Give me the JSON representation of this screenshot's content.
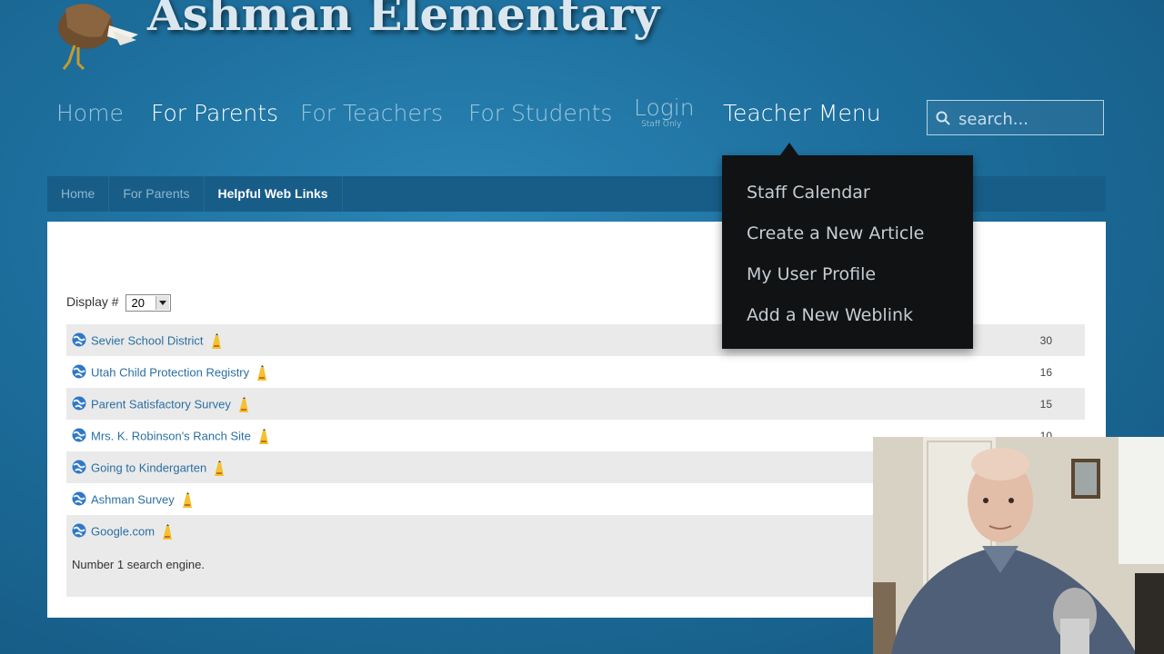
{
  "site": {
    "title": "Ashman Elementary"
  },
  "nav": {
    "items": [
      "Home",
      "For Parents",
      "For Teachers",
      "For Students"
    ],
    "login": {
      "label": "Login",
      "sub": "Staff Only"
    },
    "teacher_menu": "Teacher Menu"
  },
  "search": {
    "placeholder": "search..."
  },
  "breadcrumb": [
    "Home",
    "For Parents",
    "Helpful Web Links"
  ],
  "teacher_dropdown": [
    "Staff Calendar",
    "Create a New Article",
    "My User Profile",
    "Add a New Weblink"
  ],
  "display": {
    "label": "Display #",
    "value": "20"
  },
  "weblinks": [
    {
      "title": "Sevier School District",
      "hits": "30"
    },
    {
      "title": "Utah Child Protection Registry",
      "hits": "16"
    },
    {
      "title": "Parent Satisfactory Survey",
      "hits": "15"
    },
    {
      "title": "Mrs. K. Robinson's Ranch Site",
      "hits": "10"
    },
    {
      "title": "Going to Kindergarten",
      "hits": ""
    },
    {
      "title": "Ashman Survey",
      "hits": ""
    },
    {
      "title": "Google.com",
      "hits": "",
      "description": "Number 1 search engine."
    }
  ],
  "colors": {
    "background": "#1d6e9c",
    "link": "#2a6fa4",
    "menu_bg": "#101214"
  }
}
